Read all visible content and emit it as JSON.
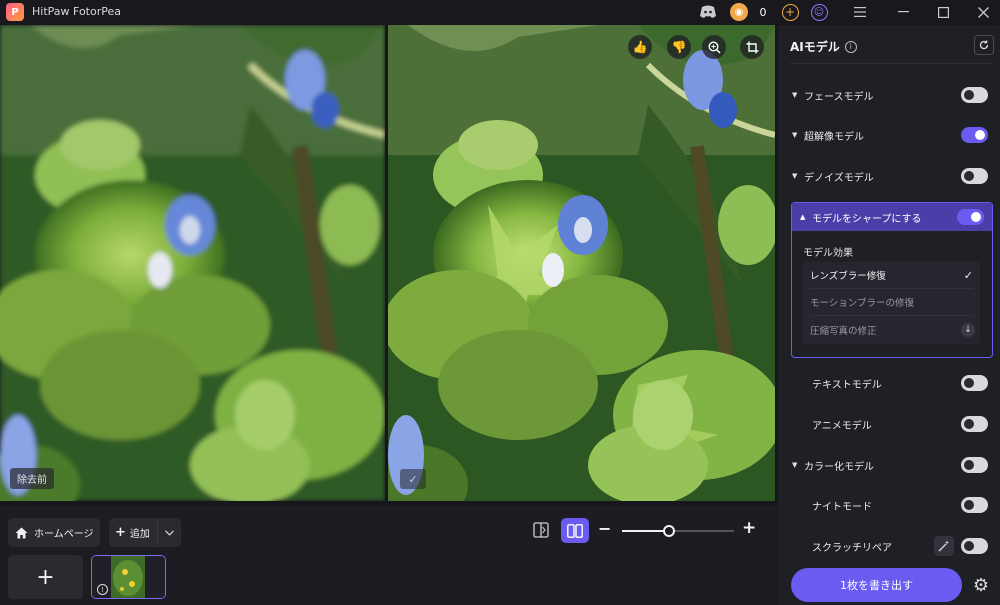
{
  "app": {
    "title": "HitPaw FotorPea",
    "logo_letter": "P"
  },
  "titlebar": {
    "coin_count": "0"
  },
  "preview": {
    "before_label": "除去前"
  },
  "bottom": {
    "home_label": "ホームページ",
    "add_label": "追加",
    "zoom_percent": 42
  },
  "panel": {
    "title": "AIモデル",
    "models": [
      {
        "label": "フェースモデル",
        "enabled": false,
        "collapsible": true
      },
      {
        "label": "超解像モデル",
        "enabled": true,
        "collapsible": true
      },
      {
        "label": "デノイズモデル",
        "enabled": false,
        "collapsible": true
      },
      {
        "label": "モデルをシャープにする",
        "enabled": true,
        "collapsible": true,
        "expanded": true
      },
      {
        "label": "テキストモデル",
        "enabled": false,
        "collapsible": false
      },
      {
        "label": "アニメモデル",
        "enabled": false,
        "collapsible": false
      },
      {
        "label": "カラー化モデル",
        "enabled": false,
        "collapsible": true
      },
      {
        "label": "ナイトモード",
        "enabled": false,
        "collapsible": false
      },
      {
        "label": "スクラッチリペア",
        "enabled": false,
        "collapsible": false
      }
    ],
    "effect_title": "モデル効果",
    "effects": [
      {
        "label": "レンズブラー修復",
        "selected": true
      },
      {
        "label": "モーションブラーの修復",
        "selected": false
      },
      {
        "label": "圧縮写真の修正",
        "selected": false
      }
    ],
    "export_label": "1枚を書き出す"
  },
  "colors": {
    "accent": "#6a5cf0",
    "panel_bg": "#1f1f26",
    "app_bg": "#16161c"
  }
}
